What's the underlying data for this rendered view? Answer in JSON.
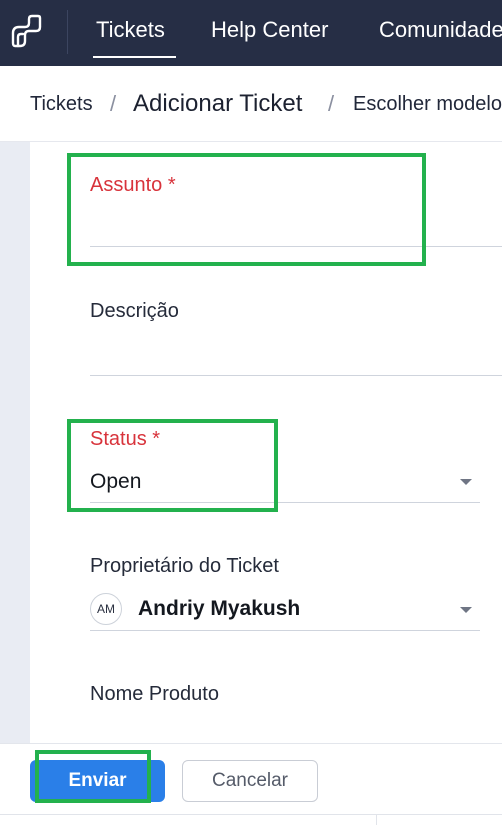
{
  "nav": {
    "logo_icon": "helpdesk-logo-icon",
    "items": [
      {
        "label": "Tickets",
        "active": true
      },
      {
        "label": "Help Center",
        "active": false
      },
      {
        "label": "Comunidade",
        "active": false
      }
    ]
  },
  "breadcrumb": {
    "root": "Tickets",
    "separator": "/",
    "current": "Adicionar Ticket",
    "template": "Escolher modelo"
  },
  "form": {
    "subject": {
      "label": "Assunto",
      "required_mark": "*",
      "value": ""
    },
    "description": {
      "label": "Descrição",
      "value": ""
    },
    "status": {
      "label": "Status",
      "required_mark": "*",
      "value": "Open"
    },
    "owner": {
      "label": "Proprietário do Ticket",
      "avatar_initials": "AM",
      "value": "Andriy Myakush"
    },
    "product": {
      "label": "Nome Produto"
    }
  },
  "actions": {
    "submit_label": "Enviar",
    "cancel_label": "Cancelar"
  },
  "colors": {
    "nav_background": "#262e45",
    "required_label": "#d8333b",
    "primary_button": "#2a7fe8",
    "highlight_box": "#23b14d"
  }
}
